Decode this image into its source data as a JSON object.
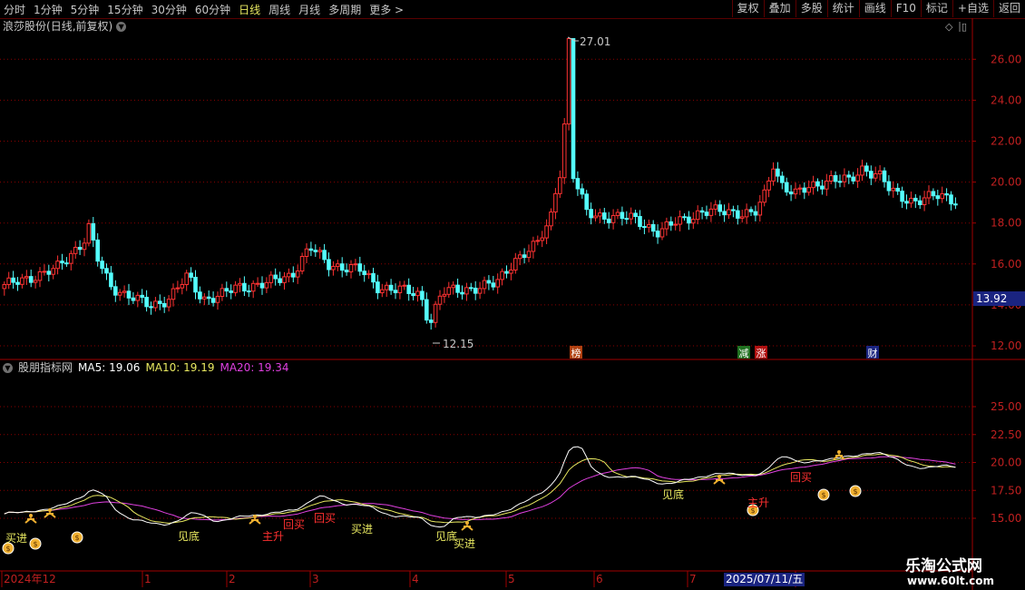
{
  "toolbar": {
    "timeframes": [
      "分时",
      "1分钟",
      "5分钟",
      "15分钟",
      "30分钟",
      "60分钟",
      "日线",
      "周线",
      "月线",
      "多周期",
      "更多 >"
    ],
    "active_timeframe": "日线",
    "buttons": [
      "复权",
      "叠加",
      "多股",
      "统计",
      "画线",
      "F10",
      "标记",
      "+自选",
      "返回"
    ]
  },
  "stock": {
    "name": "浪莎股份",
    "period_label": "(日线,前复权)"
  },
  "price_axis": {
    "ticks": [
      "26.00",
      "24.00",
      "22.00",
      "20.00",
      "18.00",
      "16.00",
      "14.00",
      "12.00"
    ]
  },
  "current_price": "13.92",
  "annotations": {
    "high": "27.01",
    "low": "12.15"
  },
  "event_markers": [
    {
      "text": "榜",
      "color": "#b04010"
    },
    {
      "text": "减",
      "color": "#207020"
    },
    {
      "text": "涨",
      "color": "#b01010"
    },
    {
      "text": "财",
      "color": "#1a2480"
    }
  ],
  "indicator": {
    "name": "股朋指标网",
    "ma5_label": "MA5: 19.06",
    "ma10_label": "MA10: 19.19",
    "ma20_label": "MA20: 19.34",
    "ma5_color": "#ffffff",
    "ma10_color": "#e8e860",
    "ma20_color": "#e040e0",
    "ticks": [
      "25.00",
      "22.50",
      "20.00",
      "17.50",
      "15.00"
    ]
  },
  "signals": [
    {
      "text": "买进",
      "color": "#e8e860"
    },
    {
      "text": "见底",
      "color": "#e8e860"
    },
    {
      "text": "主升",
      "color": "#ff3030"
    },
    {
      "text": "回买",
      "color": "#ff3030"
    },
    {
      "text": "回买",
      "color": "#ff3030"
    },
    {
      "text": "买进",
      "color": "#e8e860"
    },
    {
      "text": "见底",
      "color": "#e8e860"
    },
    {
      "text": "买进",
      "color": "#e8e860"
    },
    {
      "text": "见底",
      "color": "#e8e860"
    },
    {
      "text": "主升",
      "color": "#ff3030"
    },
    {
      "text": "回买",
      "color": "#ff3030"
    }
  ],
  "date_axis": {
    "labels": [
      "2024年12",
      "1",
      "2",
      "3",
      "4",
      "5",
      "6",
      "7",
      "8"
    ]
  },
  "cursor_date": "2025/07/11/五",
  "watermark": {
    "title": "乐淘公式网",
    "url": "www.60lt.com"
  },
  "colors": {
    "up": "#ff3232",
    "down": "#54ffff",
    "grid": "#8a0000",
    "border": "#a00000"
  }
}
